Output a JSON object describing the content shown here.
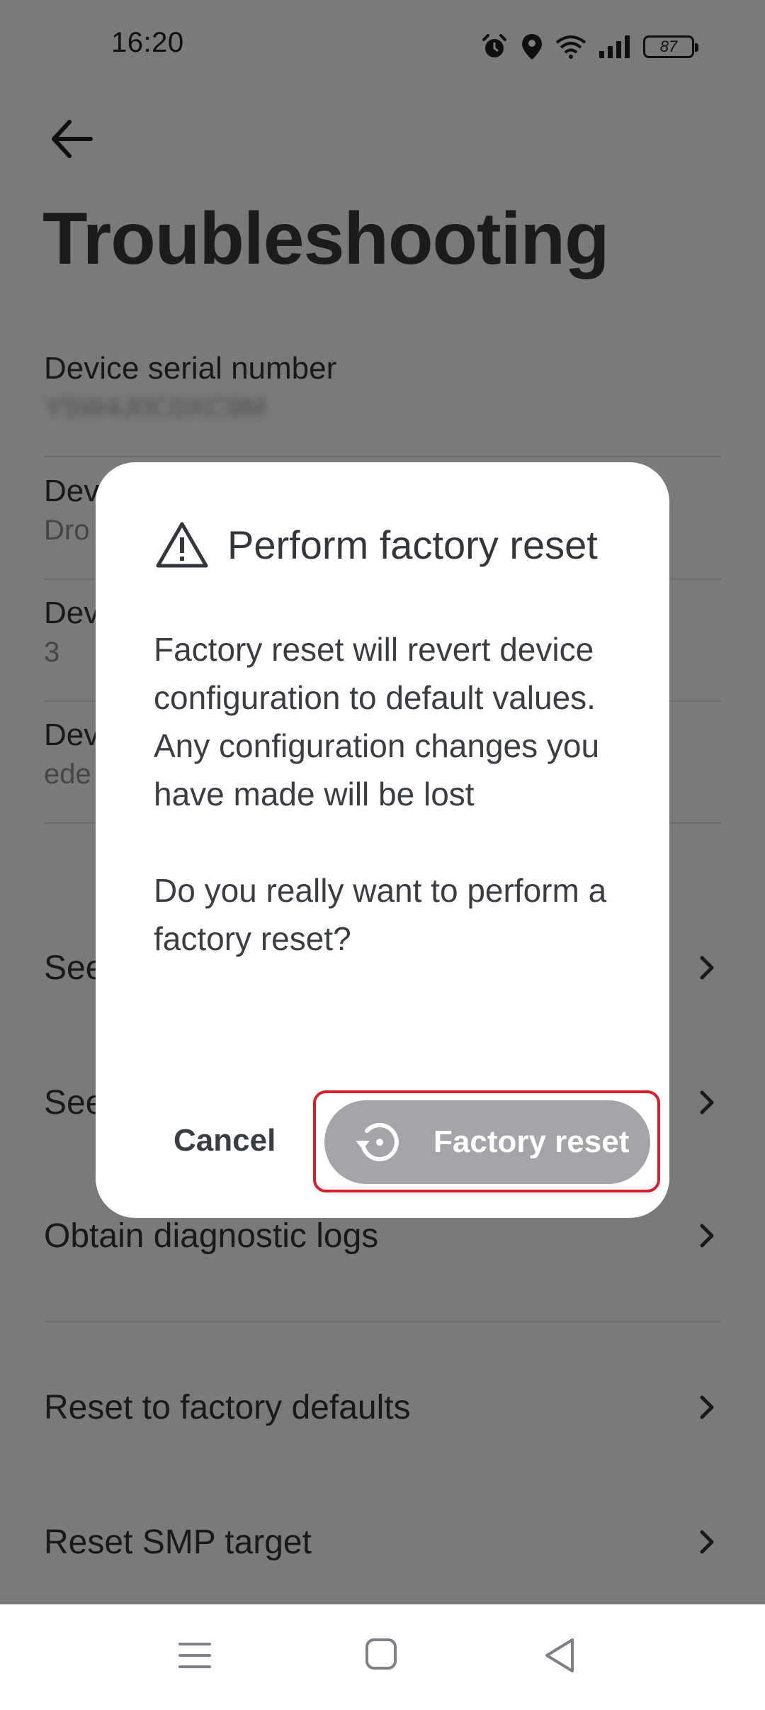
{
  "status_bar": {
    "time": "16:20",
    "battery": "87",
    "icons": [
      "alarm-icon",
      "location-icon",
      "wifi-icon",
      "signal-icon",
      "battery-icon"
    ]
  },
  "page": {
    "title": "Troubleshooting"
  },
  "info_rows": [
    {
      "label": "Device serial number",
      "value": "Y5W4J0C0XC9M"
    },
    {
      "label": "Dev",
      "value": "Dro"
    },
    {
      "label": "Dev",
      "value": "3"
    },
    {
      "label": "Dev",
      "value": "ede"
    }
  ],
  "actions": [
    {
      "label": "See"
    },
    {
      "label": "See"
    },
    {
      "label": "Obtain diagnostic logs"
    },
    {
      "label": "Reset to factory defaults"
    },
    {
      "label": "Reset SMP target"
    }
  ],
  "dialog": {
    "title": "Perform factory reset",
    "body_1": "Factory reset will revert device configuration to default values. Any configuration changes you have made will be lost",
    "body_2": "Do you really want to perform a factory reset?",
    "cancel_label": "Cancel",
    "confirm_label": "Factory reset",
    "highlight_color": "#d81e28"
  },
  "nav_bar": {
    "icons": [
      "menu-icon",
      "home-icon",
      "back-triangle-icon"
    ]
  }
}
